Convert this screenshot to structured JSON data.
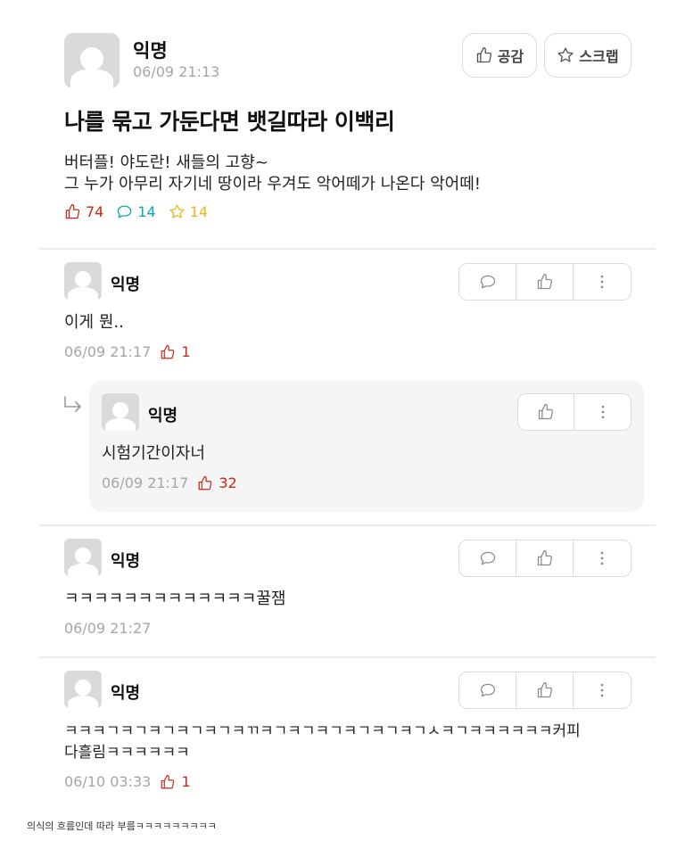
{
  "post": {
    "author": "익명",
    "timestamp": "06/09 21:13",
    "empathize_label": "공감",
    "scrap_label": "스크랩",
    "title": "나를 묶고 가둔다면 뱃길따라 이백리",
    "body_lines": [
      "버터플! 야도란! 새들의 고향~",
      "그 누가 아무리 자기네 땅이라 우겨도 악어떼가 나온다 악어떼!"
    ],
    "likes": "74",
    "comments": "14",
    "scraps": "14"
  },
  "comments": [
    {
      "author": "익명",
      "text": "이게 뭔..",
      "timestamp": "06/09 21:17",
      "likes": "1"
    },
    {
      "author": "익명",
      "text": "ㅋㅋㅋㅋㅋㅋㅋㅋㅋㅋㅋㅋㅋ꿀잼",
      "timestamp": "06/09 21:27",
      "likes": ""
    },
    {
      "author": "익명",
      "text_lines": [
        "ㅋㅋㅋㄱㅋㄱㅋㄱㅋㄱㅋㄱㅋㄲㅋㄱㅋㄱㅋㄱㅋㄱㅋㄱㅋㄱㅅㅋㄱㅋㅋㅋㅋㅋㅋ커피",
        "다흘림ㅋㅋㅋㅋㅋㅋ"
      ],
      "timestamp": "06/10 03:33",
      "likes": "1"
    }
  ],
  "reply": {
    "author": "익명",
    "text": "시험기간이자너",
    "timestamp": "06/09 21:17",
    "likes": "32"
  },
  "caption": "의식의 흐름인데 따라 부름ㅋㅋㅋㅋㅋㅋㅋㅋㅋ",
  "colors": {
    "like": "#c62917",
    "comment": "#0ca5b0",
    "scrap": "#f2b51b",
    "meta": "#a6a6a6",
    "border": "#dcdcdc"
  },
  "icons": [
    "thumbs-up-icon",
    "star-icon",
    "speech-bubble-icon",
    "more-vertical-icon",
    "reply-arrow-icon"
  ]
}
